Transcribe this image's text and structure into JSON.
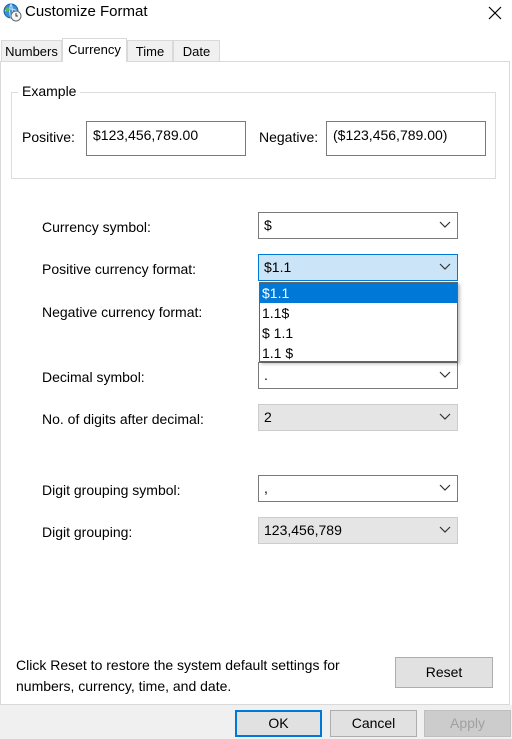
{
  "window": {
    "title": "Customize Format",
    "icon": "globe-clock-icon",
    "close_icon": "close-icon"
  },
  "tabs": [
    {
      "label": "Numbers",
      "active": false
    },
    {
      "label": "Currency",
      "active": true
    },
    {
      "label": "Time",
      "active": false
    },
    {
      "label": "Date",
      "active": false
    }
  ],
  "example": {
    "legend": "Example",
    "positive_label": "Positive:",
    "positive_value": "$123,456,789.00",
    "negative_label": "Negative:",
    "negative_value": "($123,456,789.00)"
  },
  "settings": {
    "currency_symbol": {
      "label": "Currency symbol:",
      "value": "$"
    },
    "positive_format": {
      "label": "Positive currency format:",
      "value": "$1.1"
    },
    "negative_format": {
      "label": "Negative currency format:"
    },
    "decimal_symbol": {
      "label": "Decimal symbol:",
      "value": "."
    },
    "digits_after_decimal": {
      "label": "No. of digits after decimal:",
      "value": "2"
    },
    "digit_grouping_symbol": {
      "label": "Digit grouping symbol:",
      "value": ","
    },
    "digit_grouping": {
      "label": "Digit grouping:",
      "value": "123,456,789"
    }
  },
  "dropdown": {
    "options": [
      "$1.1",
      "1.1$",
      "$ 1.1",
      "1.1 $"
    ],
    "selected_index": 0
  },
  "reset": {
    "note": "Click Reset to restore the system default settings for numbers, currency, time, and date.",
    "button_label": "Reset"
  },
  "footer": {
    "ok_label": "OK",
    "cancel_label": "Cancel",
    "apply_label": "Apply"
  },
  "colors": {
    "accent": "#0078d7",
    "selected_combo_bg": "#cce4f7",
    "disabled_bg": "#e5e5e5"
  }
}
